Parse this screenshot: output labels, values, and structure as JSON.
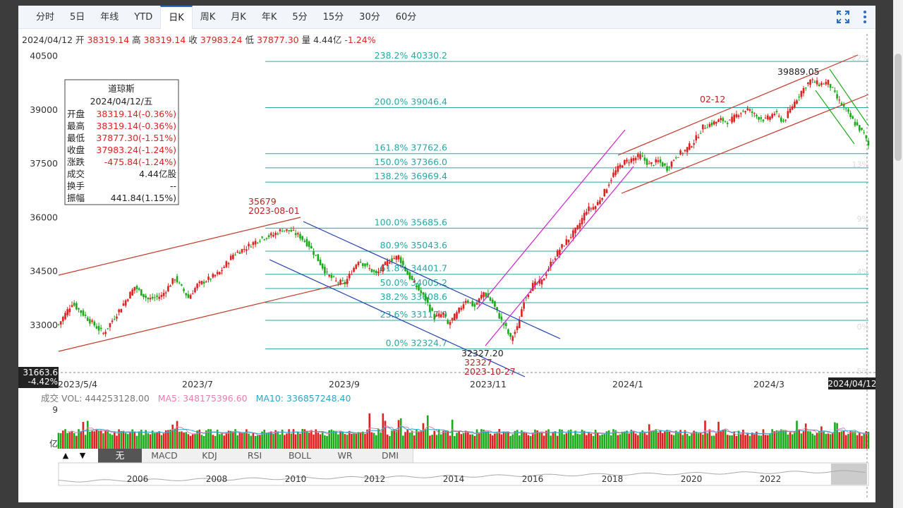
{
  "toolbar": {
    "tabs": [
      "分时",
      "5日",
      "年线",
      "YTD",
      "日K",
      "周K",
      "月K",
      "年K",
      "5分",
      "15分",
      "30分",
      "60分"
    ],
    "active_tab": "日K"
  },
  "info": {
    "date": "2024/04/12",
    "open_label": "开",
    "open": "38319.14",
    "high_label": "高",
    "high": "38319.14",
    "close_label": "收",
    "close": "37983.24",
    "low_label": "低",
    "low": "37877.30",
    "vol_label": "量",
    "vol": "4.44亿",
    "change_pct": "-1.24%"
  },
  "tooltip": {
    "name": "道琼斯",
    "date": "2024/04/12/五",
    "rows": [
      {
        "label": "开盘",
        "value": "38319.14(-0.36%)",
        "color": "#d22"
      },
      {
        "label": "最高",
        "value": "38319.14(-0.36%)",
        "color": "#d22"
      },
      {
        "label": "最低",
        "value": "37877.30(-1.51%)",
        "color": "#d22"
      },
      {
        "label": "收盘",
        "value": "37983.24(-1.24%)",
        "color": "#d22"
      },
      {
        "label": "涨跌",
        "value": "-475.84(-1.24%)",
        "color": "#d22"
      },
      {
        "label": "成交",
        "value": "4.44亿股",
        "color": "#222"
      },
      {
        "label": "换手",
        "value": "--",
        "color": "#222"
      },
      {
        "label": "振幅",
        "value": "441.84(1.15%)",
        "color": "#222"
      }
    ]
  },
  "crosshair": {
    "price_label": "31663.6",
    "pct_label": "-4.42%",
    "date_label": "2024/04/12"
  },
  "volume_info": {
    "label": "成交",
    "vol_text": "VOL: 444253128.00",
    "ma5_text": "MA5: 348175396.60",
    "ma10_text": "MA10: 336857248.40",
    "axis_top": "9",
    "axis_unit": "亿",
    "ma5_color": "#e87fb0",
    "ma10_color": "#2aa6c9"
  },
  "indicators": {
    "buttons": [
      "无",
      "MACD",
      "KDJ",
      "RSI",
      "BOLL",
      "WR",
      "DMI"
    ],
    "active": "无",
    "up_arrow": "▲",
    "down_arrow": "▼"
  },
  "overview": {
    "years": [
      "2006",
      "2008",
      "2010",
      "2012",
      "2014",
      "2016",
      "2018",
      "2020",
      "2022"
    ]
  },
  "colors": {
    "up": "#e02020",
    "down": "#1aaa1a",
    "fib": "#2aa6a6",
    "channel_red": "#c0392b",
    "channel_blue": "#1f3faa",
    "channel_magenta": "#cc22cc",
    "channel_green": "#22aa22",
    "accent": "#2b6cc4"
  },
  "chart_data": {
    "type": "candlestick",
    "title": "道琼斯",
    "x_tick_labels": [
      "2023/5/4",
      "2023/7",
      "2023/9",
      "2023/11",
      "2024/1",
      "2024/3"
    ],
    "y_ticks": [
      33000,
      34500,
      36000,
      37500,
      39000,
      40500
    ],
    "ylim": [
      32000,
      40700
    ],
    "right_pct_ticks": [
      "22%",
      "13%",
      "9%",
      "4%",
      "0%",
      "-5%"
    ],
    "fibonacci_levels": [
      {
        "label": "238.2% 40330.2",
        "value": 40330.2
      },
      {
        "label": "200.0% 39046.4",
        "value": 39046.4
      },
      {
        "label": "161.8% 37762.6",
        "value": 37762.6
      },
      {
        "label": "150.0% 37366.0",
        "value": 37366.0
      },
      {
        "label": "138.2% 36969.4",
        "value": 36969.4
      },
      {
        "label": "100.0% 35685.6",
        "value": 35685.6
      },
      {
        "label": "80.9% 35043.6",
        "value": 35043.6
      },
      {
        "label": "61.8% 34401.7",
        "value": 34401.7
      },
      {
        "label": "50.0% 34005.2",
        "value": 34005.2
      },
      {
        "label": "38.2% 33608.6",
        "value": 33608.6
      },
      {
        "label": "23.6% 33117.9",
        "value": 33117.9
      },
      {
        "label": "0.0% 32324.7",
        "value": 32324.7
      }
    ],
    "annotations": [
      {
        "text": "35679",
        "sub": "2023-08-01",
        "value": 35679
      },
      {
        "text": "32327.20",
        "value": 32327.2
      },
      {
        "text": "32327",
        "sub": "2023-10-27",
        "value": 32327
      },
      {
        "text": "39889.05",
        "value": 39889.05
      },
      {
        "text": "02-12"
      }
    ],
    "close_anchors": [
      [
        0,
        33000
      ],
      [
        6,
        33600
      ],
      [
        14,
        33100
      ],
      [
        20,
        32750
      ],
      [
        26,
        33300
      ],
      [
        34,
        34050
      ],
      [
        40,
        33700
      ],
      [
        46,
        33800
      ],
      [
        52,
        34300
      ],
      [
        58,
        33750
      ],
      [
        62,
        34100
      ],
      [
        68,
        34300
      ],
      [
        72,
        34450
      ],
      [
        78,
        34950
      ],
      [
        84,
        35150
      ],
      [
        90,
        35400
      ],
      [
        96,
        35500
      ],
      [
        100,
        35650
      ],
      [
        104,
        35600
      ],
      [
        108,
        35450
      ],
      [
        112,
        35200
      ],
      [
        116,
        34800
      ],
      [
        120,
        34400
      ],
      [
        124,
        34200
      ],
      [
        128,
        34150
      ],
      [
        134,
        34800
      ],
      [
        138,
        34600
      ],
      [
        142,
        34400
      ],
      [
        148,
        34800
      ],
      [
        152,
        34900
      ],
      [
        156,
        34400
      ],
      [
        160,
        34050
      ],
      [
        164,
        33700
      ],
      [
        168,
        33200
      ],
      [
        172,
        33300
      ],
      [
        174,
        33000
      ],
      [
        178,
        33300
      ],
      [
        182,
        33700
      ],
      [
        186,
        33500
      ],
      [
        190,
        33900
      ],
      [
        194,
        33600
      ],
      [
        198,
        33100
      ],
      [
        200,
        32900
      ],
      [
        202,
        32600
      ],
      [
        205,
        32900
      ],
      [
        208,
        33700
      ],
      [
        212,
        34100
      ],
      [
        216,
        34200
      ],
      [
        220,
        34700
      ],
      [
        224,
        35100
      ],
      [
        228,
        35400
      ],
      [
        232,
        35700
      ],
      [
        236,
        36200
      ],
      [
        240,
        36300
      ],
      [
        244,
        36700
      ],
      [
        248,
        37200
      ],
      [
        252,
        37500
      ],
      [
        256,
        37600
      ],
      [
        260,
        37700
      ],
      [
        264,
        37450
      ],
      [
        268,
        37550
      ],
      [
        272,
        37350
      ],
      [
        276,
        37700
      ],
      [
        280,
        37850
      ],
      [
        284,
        38100
      ],
      [
        288,
        38500
      ],
      [
        292,
        38600
      ],
      [
        296,
        38700
      ],
      [
        300,
        38650
      ],
      [
        304,
        38900
      ],
      [
        308,
        39000
      ],
      [
        312,
        38800
      ],
      [
        316,
        38700
      ],
      [
        320,
        38900
      ],
      [
        324,
        38650
      ],
      [
        328,
        39100
      ],
      [
        332,
        39500
      ],
      [
        336,
        39800
      ],
      [
        340,
        39700
      ],
      [
        344,
        39750
      ],
      [
        348,
        39300
      ],
      [
        352,
        38950
      ],
      [
        356,
        38600
      ],
      [
        360,
        38300
      ],
      [
        362,
        37983
      ]
    ]
  }
}
